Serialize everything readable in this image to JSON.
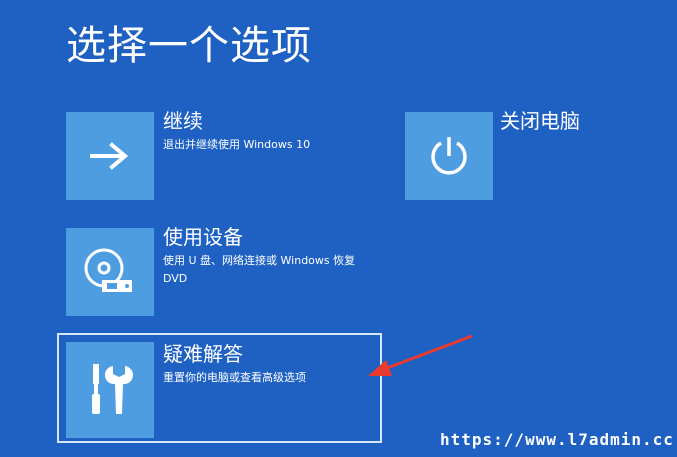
{
  "screen": {
    "title": "选择一个选项",
    "background_color": "#1e61c2",
    "tile_color": "#4d9de0"
  },
  "options": [
    {
      "id": "continue",
      "icon": "arrow-right-icon",
      "title": "继续",
      "description": "退出并继续使用 Windows 10"
    },
    {
      "id": "shutdown",
      "icon": "power-icon",
      "title": "关闭电脑"
    },
    {
      "id": "use-device",
      "icon": "disc-drive-icon",
      "title": "使用设备",
      "description": "使用 U 盘、网络连接或 Windows 恢复 DVD"
    },
    {
      "id": "troubleshoot",
      "icon": "tools-icon",
      "title": "疑难解答",
      "description": "重置你的电脑或查看高级选项",
      "selected": true
    }
  ],
  "annotation": {
    "arrow_color": "#e83a2e"
  },
  "watermark": {
    "text": "https://www.l7admin.cc"
  }
}
